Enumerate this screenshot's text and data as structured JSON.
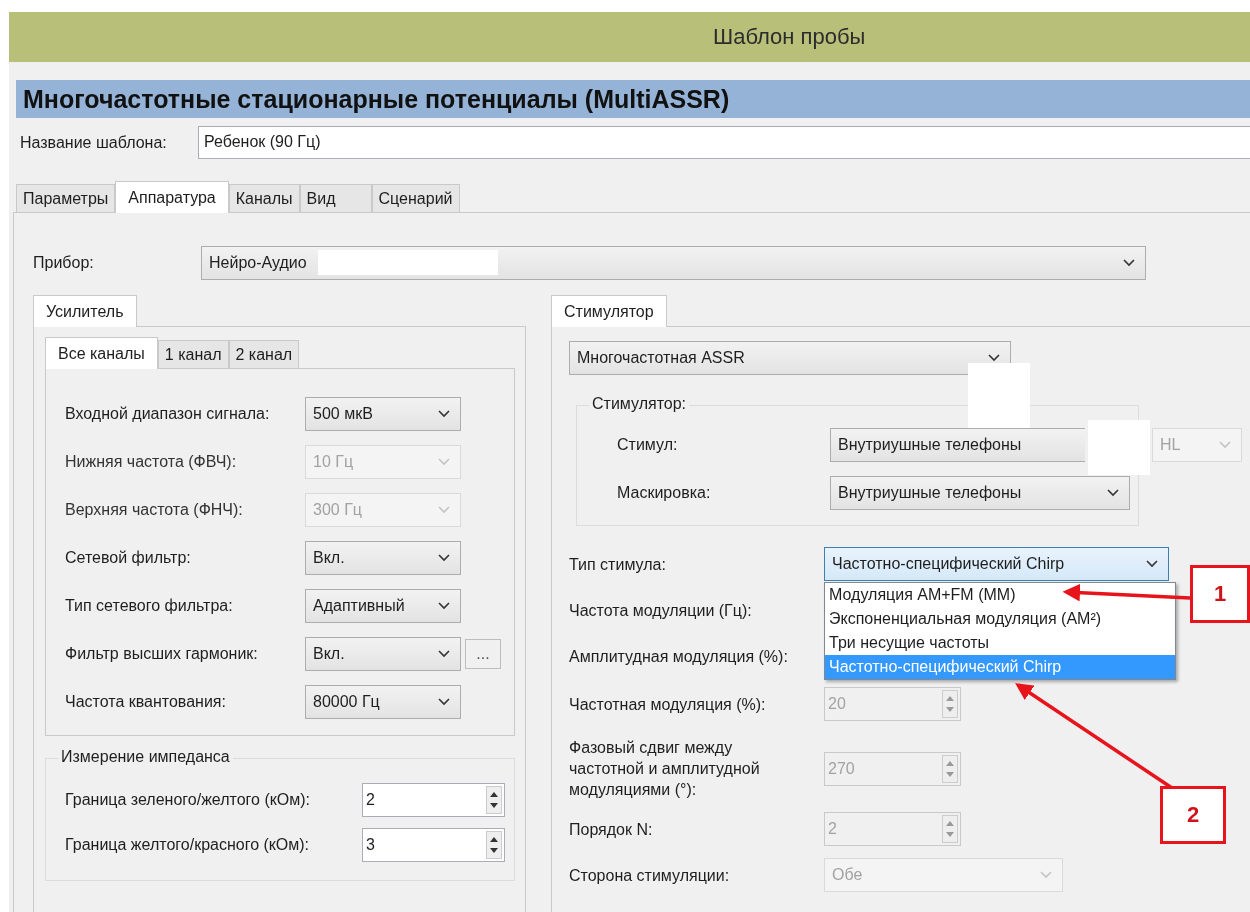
{
  "window": {
    "title": "Шаблон пробы"
  },
  "header": "Многочастотные стационарные потенциалы (MultiASSR)",
  "template_name": {
    "label": "Название шаблона:",
    "value": "Ребенок (90 Гц)"
  },
  "tabs": [
    {
      "label": "Параметры",
      "selected": false
    },
    {
      "label": "Аппаратура",
      "selected": true
    },
    {
      "label": "Каналы",
      "selected": false
    },
    {
      "label": "Вид",
      "selected": false
    },
    {
      "label": "Сценарий",
      "selected": false
    }
  ],
  "device": {
    "label": "Прибор:",
    "value": "Нейро-Аудио"
  },
  "amplifier": {
    "tab": "Усилитель",
    "channel_tabs": [
      {
        "label": "Все каналы",
        "selected": true
      },
      {
        "label": "1 канал",
        "selected": false
      },
      {
        "label": "2 канал",
        "selected": false
      }
    ],
    "rows": [
      {
        "label": "Входной диапазон сигнала:",
        "value": "500 мкВ",
        "disabled": false
      },
      {
        "label": "Нижняя частота (ФВЧ):",
        "value": "10 Гц",
        "disabled": true
      },
      {
        "label": "Верхняя частота (ФНЧ):",
        "value": "300 Гц",
        "disabled": true
      },
      {
        "label": "Сетевой фильтр:",
        "value": "Вкл.",
        "disabled": false
      },
      {
        "label": "Тип сетевого фильтра:",
        "value": "Адаптивный",
        "disabled": false
      },
      {
        "label": "Фильтр высших гармоник:",
        "value": "Вкл.",
        "disabled": false,
        "more_button": "..."
      },
      {
        "label": "Частота квантования:",
        "value": "80000 Гц",
        "disabled": false
      }
    ],
    "impedance": {
      "title": "Измерение импеданса",
      "rows": [
        {
          "label": "Граница зеленого/желтого (кОм):",
          "value": "2"
        },
        {
          "label": "Граница желтого/красного (кОм):",
          "value": "3"
        }
      ]
    }
  },
  "stimulator": {
    "tab": "Стимулятор",
    "mode": "Многочастотная ASSR",
    "group": {
      "title": "Стимулятор:",
      "rows": [
        {
          "label": "Стимул:",
          "value": "Внутриушные телефоны",
          "extra": {
            "value": "HL",
            "disabled": true
          }
        },
        {
          "label": "Маскировка:",
          "value": "Внутриушные телефоны"
        }
      ]
    },
    "stimulus_type": {
      "label": "Тип стимула:",
      "value": "Частотно-специфический Chirp",
      "open": true,
      "options": [
        {
          "label": "Модуляция AM+FM (MM)",
          "selected": false
        },
        {
          "label": "Экспоненциальная модуляция (AM²)",
          "selected": false
        },
        {
          "label": "Три несущие частоты",
          "selected": false
        },
        {
          "label": "Частотно-специфический Chirp",
          "selected": true
        }
      ]
    },
    "rows": [
      {
        "label": "Частота модуляции (Гц):",
        "kind": "label"
      },
      {
        "label": "Амплитудная модуляция (%):",
        "kind": "label"
      },
      {
        "label": "Частотная модуляция (%):",
        "kind": "spin",
        "value": "20",
        "disabled": true
      },
      {
        "label": "Фазовый сдвиг между частотной и амплитудной модуляциями (°):",
        "kind": "spin",
        "value": "270",
        "disabled": true
      },
      {
        "label": "Порядок N:",
        "kind": "spin",
        "value": "2",
        "disabled": true
      },
      {
        "label": "Сторона стимуляции:",
        "kind": "select",
        "value": "Обе",
        "disabled": true
      }
    ]
  },
  "callouts": [
    {
      "label": "1"
    },
    {
      "label": "2"
    }
  ]
}
